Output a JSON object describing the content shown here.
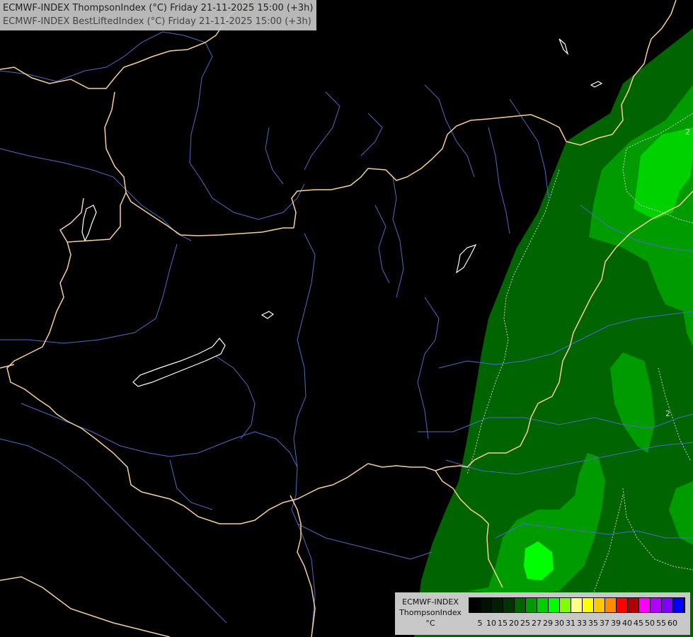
{
  "header": {
    "line1": "ECMWF-INDEX ThompsonIndex (°C) Friday 21-11-2025 15:00 (+3h)",
    "line2": "ECMWF-INDEX BestLiftedIndex (°C) Friday 21-11-2025 15:00 (+3h)"
  },
  "legend": {
    "title": "ECMWF-INDEX",
    "variable": "ThompsonIndex",
    "unit": "°C",
    "values": [
      "5",
      "10",
      "15",
      "20",
      "25",
      "27",
      "29",
      "30",
      "31",
      "33",
      "35",
      "37",
      "39",
      "40",
      "45",
      "50",
      "55",
      "60"
    ],
    "colors": [
      "#000000",
      "#001200",
      "#002000",
      "#003400",
      "#006400",
      "#009b00",
      "#00d200",
      "#00ff00",
      "#80ff00",
      "#ffff80",
      "#ffff00",
      "#ffc800",
      "#ff8c00",
      "#ff0000",
      "#b00000",
      "#ff00ff",
      "#b000ff",
      "#8000ff",
      "#0000ff"
    ]
  },
  "contour_labels": [
    "2",
    "2"
  ],
  "colors": {
    "borders": "#f5cf9c",
    "rivers": "#4c6cbe",
    "lakes": "#ffffff",
    "contours": "#cfcfcf"
  }
}
